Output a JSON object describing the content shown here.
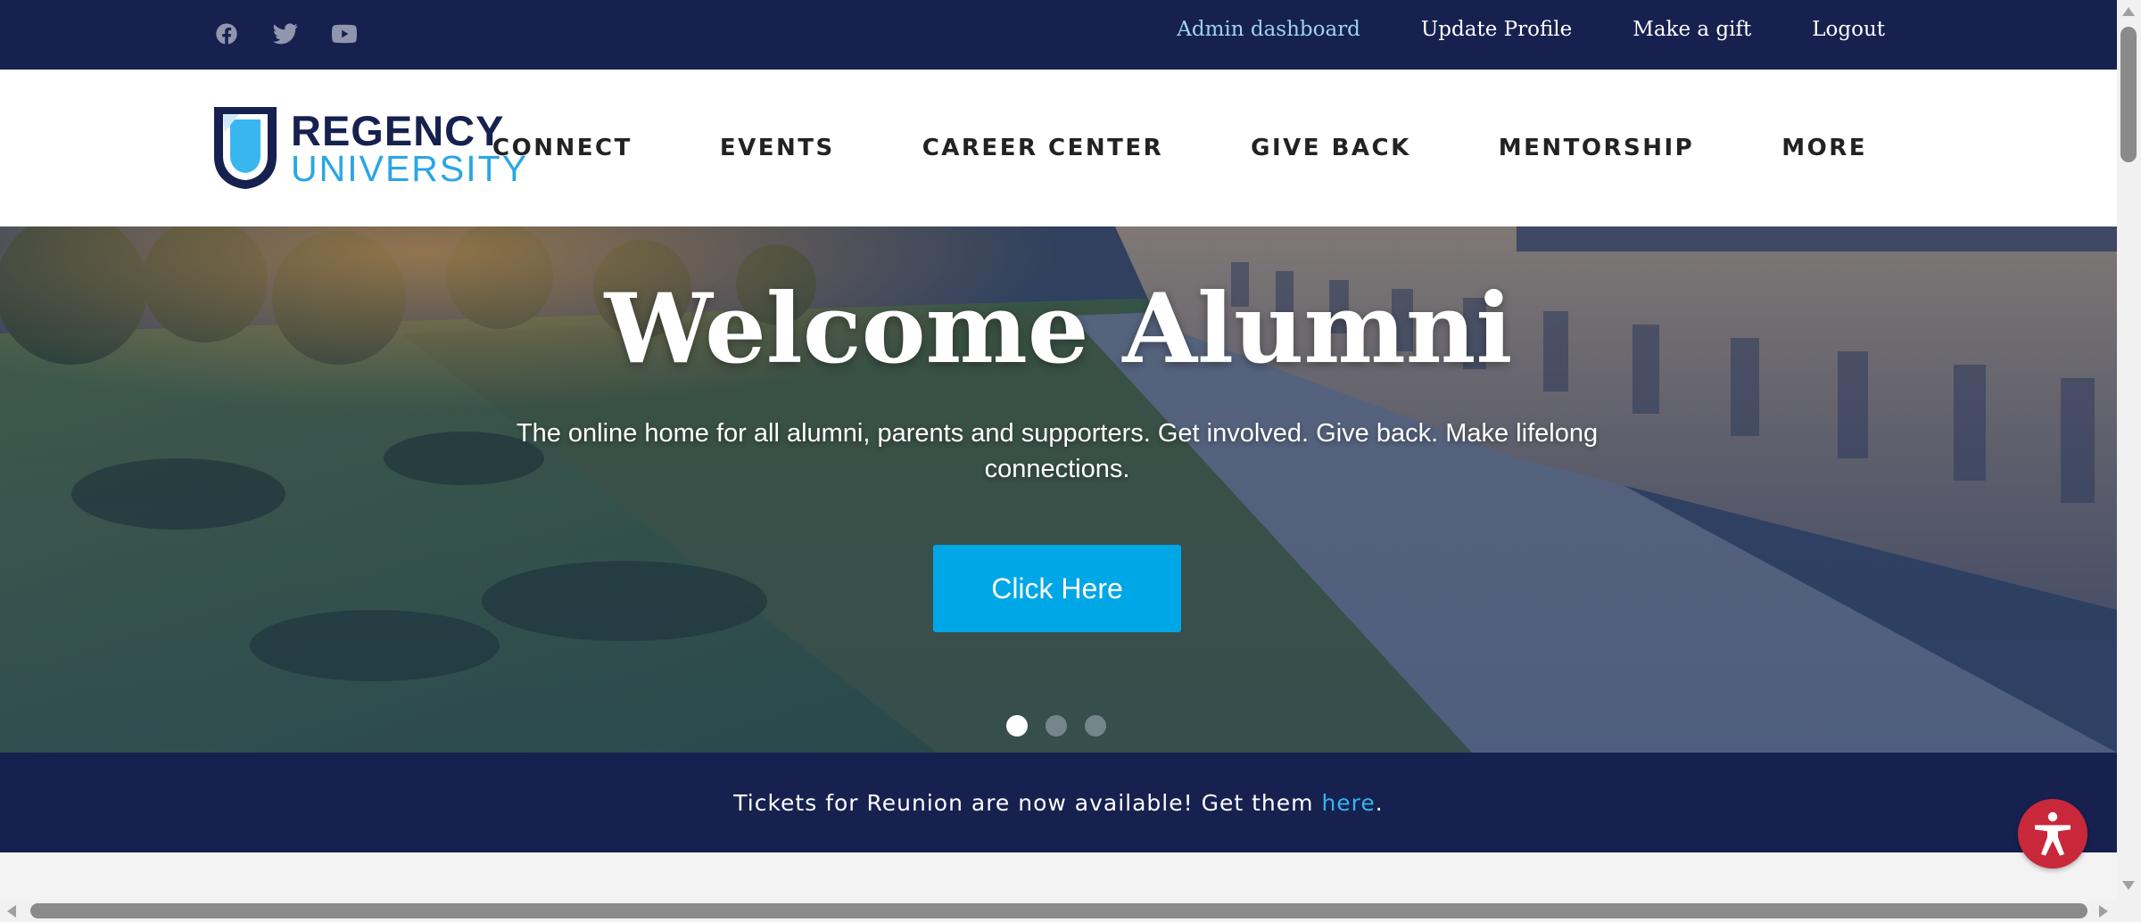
{
  "topbar": {
    "social": [
      {
        "icon": "facebook-icon"
      },
      {
        "icon": "twitter-icon"
      },
      {
        "icon": "youtube-icon"
      }
    ],
    "links": [
      {
        "label": "Admin dashboard",
        "active": true
      },
      {
        "label": "Update Profile"
      },
      {
        "label": "Make a gift"
      },
      {
        "label": "Logout"
      }
    ]
  },
  "brand": {
    "line1": "REGENCY",
    "line2": "UNIVERSITY",
    "colors": {
      "navy": "#16214f",
      "blue": "#2aa6e5"
    }
  },
  "nav": {
    "items": [
      {
        "label": "CONNECT"
      },
      {
        "label": "EVENTS"
      },
      {
        "label": "CAREER CENTER"
      },
      {
        "label": "GIVE BACK"
      },
      {
        "label": "MENTORSHIP"
      },
      {
        "label": "MORE"
      }
    ]
  },
  "hero": {
    "title": "Welcome Alumni",
    "subtitle": "The online home for all alumni, parents and supporters. Get involved. Give back. Make lifelong connections.",
    "button_label": "Click Here",
    "slides": 3,
    "active_slide": 1
  },
  "announcement": {
    "text_before": "Tickets for Reunion are now available! Get them ",
    "link_text": "here",
    "text_after": "."
  },
  "accessibility": {
    "icon": "accessibility-icon",
    "color": "#c8283a"
  },
  "colors": {
    "navy": "#16214f",
    "accent": "#00a7e6",
    "link_active": "#9fd2f2"
  }
}
